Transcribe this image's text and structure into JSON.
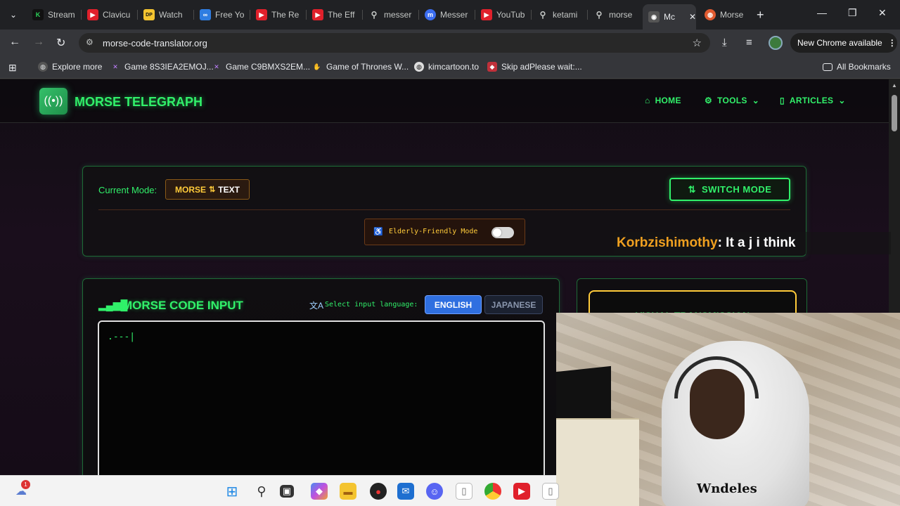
{
  "browser": {
    "tabs": [
      {
        "title": "Stream",
        "fav_color": "#2bd45a",
        "fav_char": "K"
      },
      {
        "title": "Clavicu",
        "fav_color": "#e0202b",
        "fav_char": "▶"
      },
      {
        "title": "Watch",
        "fav_color": "#f4c430",
        "fav_char": "DP"
      },
      {
        "title": "Free Yo",
        "fav_color": "#2f7de1",
        "fav_char": "∞"
      },
      {
        "title": "The Re",
        "fav_color": "#e0202b",
        "fav_char": "▶"
      },
      {
        "title": "The Eff",
        "fav_color": "#e0202b",
        "fav_char": "▶"
      },
      {
        "title": "messer",
        "fav_color": "#3a3a3a",
        "fav_char": "⚲"
      },
      {
        "title": "Messer",
        "fav_color": "#3b6df0",
        "fav_char": "m"
      },
      {
        "title": "YouTub",
        "fav_color": "#e0202b",
        "fav_char": "▶"
      },
      {
        "title": "ketami",
        "fav_color": "#3a3a3a",
        "fav_char": "⚲"
      },
      {
        "title": "morse",
        "fav_color": "#3a3a3a",
        "fav_char": "⚲"
      },
      {
        "title": "Mc",
        "fav_color": "#777777",
        "fav_char": "◉"
      },
      {
        "title": "Morse",
        "fav_color": "#e05a30",
        "fav_char": "◍"
      }
    ],
    "url": "morse-code-translator.org",
    "new_chrome_label": "New Chrome available",
    "bookmarks": [
      {
        "label": "Explore more",
        "icon": "globe-icon"
      },
      {
        "label": "Game 8S3IEA2EMOJ...",
        "icon": "x-icon"
      },
      {
        "label": "Game C9BMXS2EM...",
        "icon": "x-icon"
      },
      {
        "label": "Game of Thrones W...",
        "icon": "hand-icon"
      },
      {
        "label": "kimcartoon.to",
        "icon": "globe-icon"
      },
      {
        "label": "Skip adPlease wait:...",
        "icon": "shield-icon"
      }
    ],
    "all_bookmarks_label": "All Bookmarks"
  },
  "site": {
    "brand": "MORSE TELEGRAPH",
    "nav": {
      "home": "HOME",
      "tools": "TOOLS",
      "articles": "ARTICLES"
    },
    "mode": {
      "label": "Current Mode:",
      "badge_morse": "MORSE",
      "badge_arrow": "⇅",
      "badge_text": "TEXT",
      "switch_label": "SWITCH MODE",
      "elderly_label": "Elderly-Friendly Mode"
    },
    "input": {
      "title": "MORSE CODE INPUT",
      "lang_label": "Select input language:",
      "lang_en": "ENGLISH",
      "lang_jp": "JAPANESE",
      "value": ".---|"
    },
    "visual": {
      "title": "VISUAL TRANSMISSION"
    }
  },
  "chat": {
    "user": "Korbzishimothy",
    "message": " : It a j i think"
  },
  "webcam": {
    "shirt_text": "Wndeles"
  },
  "taskbar": {
    "notif_count": "1"
  },
  "colors": {
    "accent": "#31f06a",
    "gold": "#ffcb3a",
    "english_btn": "#2f6fe0"
  }
}
